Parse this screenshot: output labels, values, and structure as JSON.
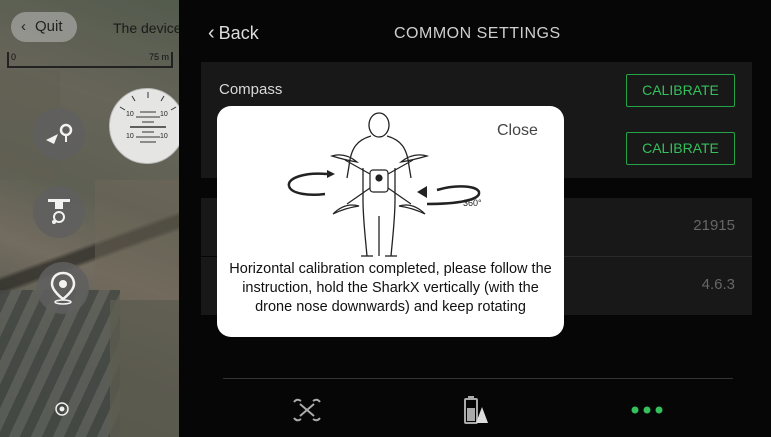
{
  "map": {
    "quit_label": "Quit",
    "device_title": "The device",
    "scale_start": "0",
    "scale_end": "75 m",
    "attitude_ticks": [
      "10",
      "10",
      "10",
      "10"
    ],
    "icons": [
      "route-plan-icon",
      "drone-follow-icon",
      "waypoint-icon",
      "locate-icon"
    ]
  },
  "header": {
    "back_label": "Back",
    "title": "COMMON SETTINGS"
  },
  "rows": [
    {
      "label": "Compass",
      "action": "CALIBRATE"
    },
    {
      "label": "",
      "action": "CALIBRATE"
    },
    {
      "label": "",
      "value": "21915"
    },
    {
      "label": "",
      "value": "4.6.3"
    }
  ],
  "modal": {
    "close_label": "Close",
    "rotation_label": "360°",
    "message": "Horizontal calibration completed, please follow the instruction, hold the SharkX vertically (with the drone nose downwards) and keep rotating"
  },
  "tabbar": {
    "tabs": [
      "drone-tab-icon",
      "battery-tab-icon",
      "more-tab-icon"
    ],
    "active_color": "#34c05a"
  },
  "colors": {
    "accent": "#34c05a",
    "background": "#060606",
    "row_bg": "#181818"
  }
}
